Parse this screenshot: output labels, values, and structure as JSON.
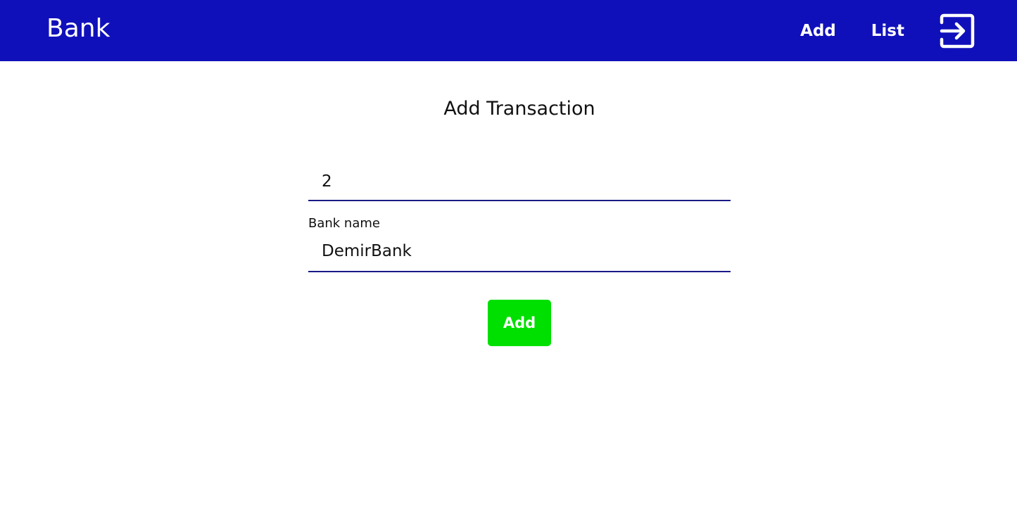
{
  "navbar": {
    "brand": "Bank",
    "links": [
      {
        "label": "Add"
      },
      {
        "label": "List"
      }
    ],
    "logout_icon": "logout-arrow-icon"
  },
  "page": {
    "title": "Add Transaction"
  },
  "form": {
    "amount": {
      "value": "2"
    },
    "bank_name": {
      "label": "Bank name",
      "value": "DemirBank"
    },
    "submit_label": "Add"
  },
  "colors": {
    "navbar_bg": "#1010bb",
    "submit_bg": "#00e000",
    "input_underline": "#1a1a88"
  }
}
